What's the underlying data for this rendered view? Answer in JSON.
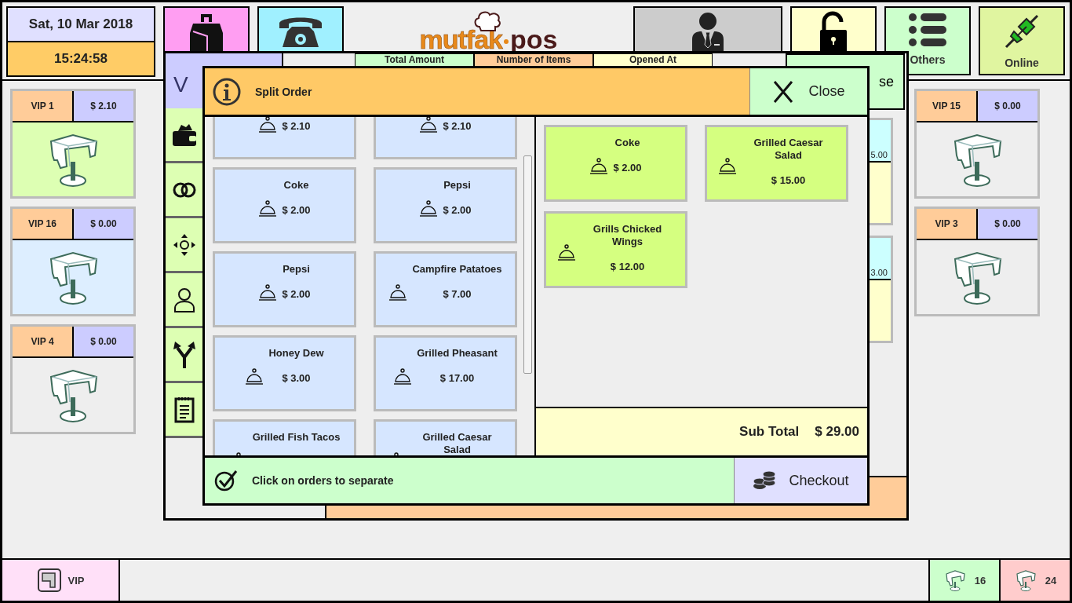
{
  "date": "Sat, 10 Mar 2018",
  "time": "15:24:58",
  "logo": [
    "mutfak",
    "pos"
  ],
  "top_buttons": [
    {
      "label": "Others"
    },
    {
      "label": "Online"
    }
  ],
  "left_tables": [
    {
      "name": "VIP 1",
      "amount": "$ 2.10",
      "color": "#ddffb3"
    },
    {
      "name": "VIP 16",
      "amount": "$ 0.00",
      "color": "#ddeeff"
    },
    {
      "name": "VIP 4",
      "amount": "$ 0.00",
      "color": "#eeeeee"
    }
  ],
  "right_tables": [
    {
      "name": "VIP 15",
      "amount": "$ 0.00",
      "color": "#eeeeee"
    },
    {
      "name": "VIP 3",
      "amount": "$ 0.00",
      "color": "#eeeeee"
    }
  ],
  "order_window": {
    "title_fragment": "V",
    "columns": [
      "Total Amount",
      "Number of Items",
      "Opened At"
    ],
    "button_fragment": "se",
    "side_values": [
      "5.00",
      "3.00"
    ]
  },
  "dialog": {
    "title": "Split Order",
    "close": "Close",
    "items": [
      {
        "price": "$ 2.10"
      },
      {
        "price": "$ 2.10"
      },
      {
        "name": "Coke",
        "price": "$ 2.00"
      },
      {
        "name": "Pepsi",
        "price": "$ 2.00"
      },
      {
        "name": "Pepsi",
        "price": "$ 2.00"
      },
      {
        "name": "Campfire Patatoes",
        "price": "$ 7.00"
      },
      {
        "name": "Honey Dew",
        "price": "$ 3.00"
      },
      {
        "name": "Grilled Pheasant",
        "price": "$ 17.00"
      },
      {
        "name": "Grilled Fish Tacos"
      },
      {
        "name": "Grilled Caesar Salad"
      }
    ],
    "selected_items": [
      {
        "name": "Coke",
        "price": "$ 2.00"
      },
      {
        "name": "Grilled Caesar Salad",
        "price": "$ 15.00"
      },
      {
        "name": "Grills Chicked Wings",
        "price": "$ 12.00"
      }
    ],
    "subtotal_label": "Sub Total",
    "subtotal": "$ 29.00",
    "hint": "Click on orders to separate",
    "checkout": "Checkout"
  },
  "status_bar": {
    "area": "VIP",
    "counts": [
      {
        "value": "16",
        "color": "#ccffcc"
      },
      {
        "value": "24",
        "color": "#ffcccc"
      }
    ]
  }
}
